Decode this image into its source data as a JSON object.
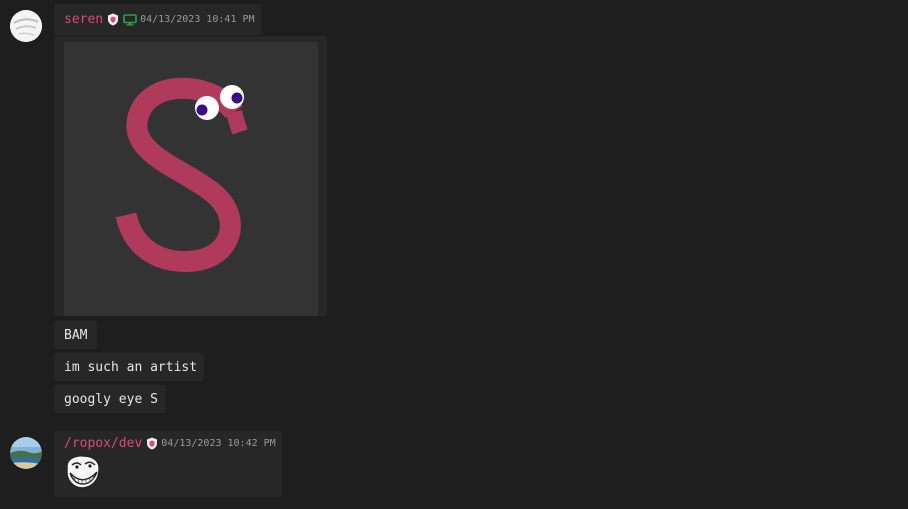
{
  "colors": {
    "background": "#1e1e1e",
    "bubble": "#272727",
    "username": "#e0457b",
    "timestamp": "#9a9a9a",
    "letter": "#b03a5b",
    "desktop_icon": "#2ea043"
  },
  "messages": [
    {
      "author": "seren",
      "badges": [
        "shield-icon",
        "desktop-icon"
      ],
      "timestamp": "04/13/2023 10:41 PM",
      "image": "drawn letter S with googly eyes",
      "lines": [
        "BAM",
        "im such an artist",
        "googly eye S"
      ]
    },
    {
      "author": "/ropox/dev",
      "badges": [
        "shield-icon"
      ],
      "timestamp": "04/13/2023 10:42 PM",
      "emoji": "trollface-icon"
    }
  ]
}
